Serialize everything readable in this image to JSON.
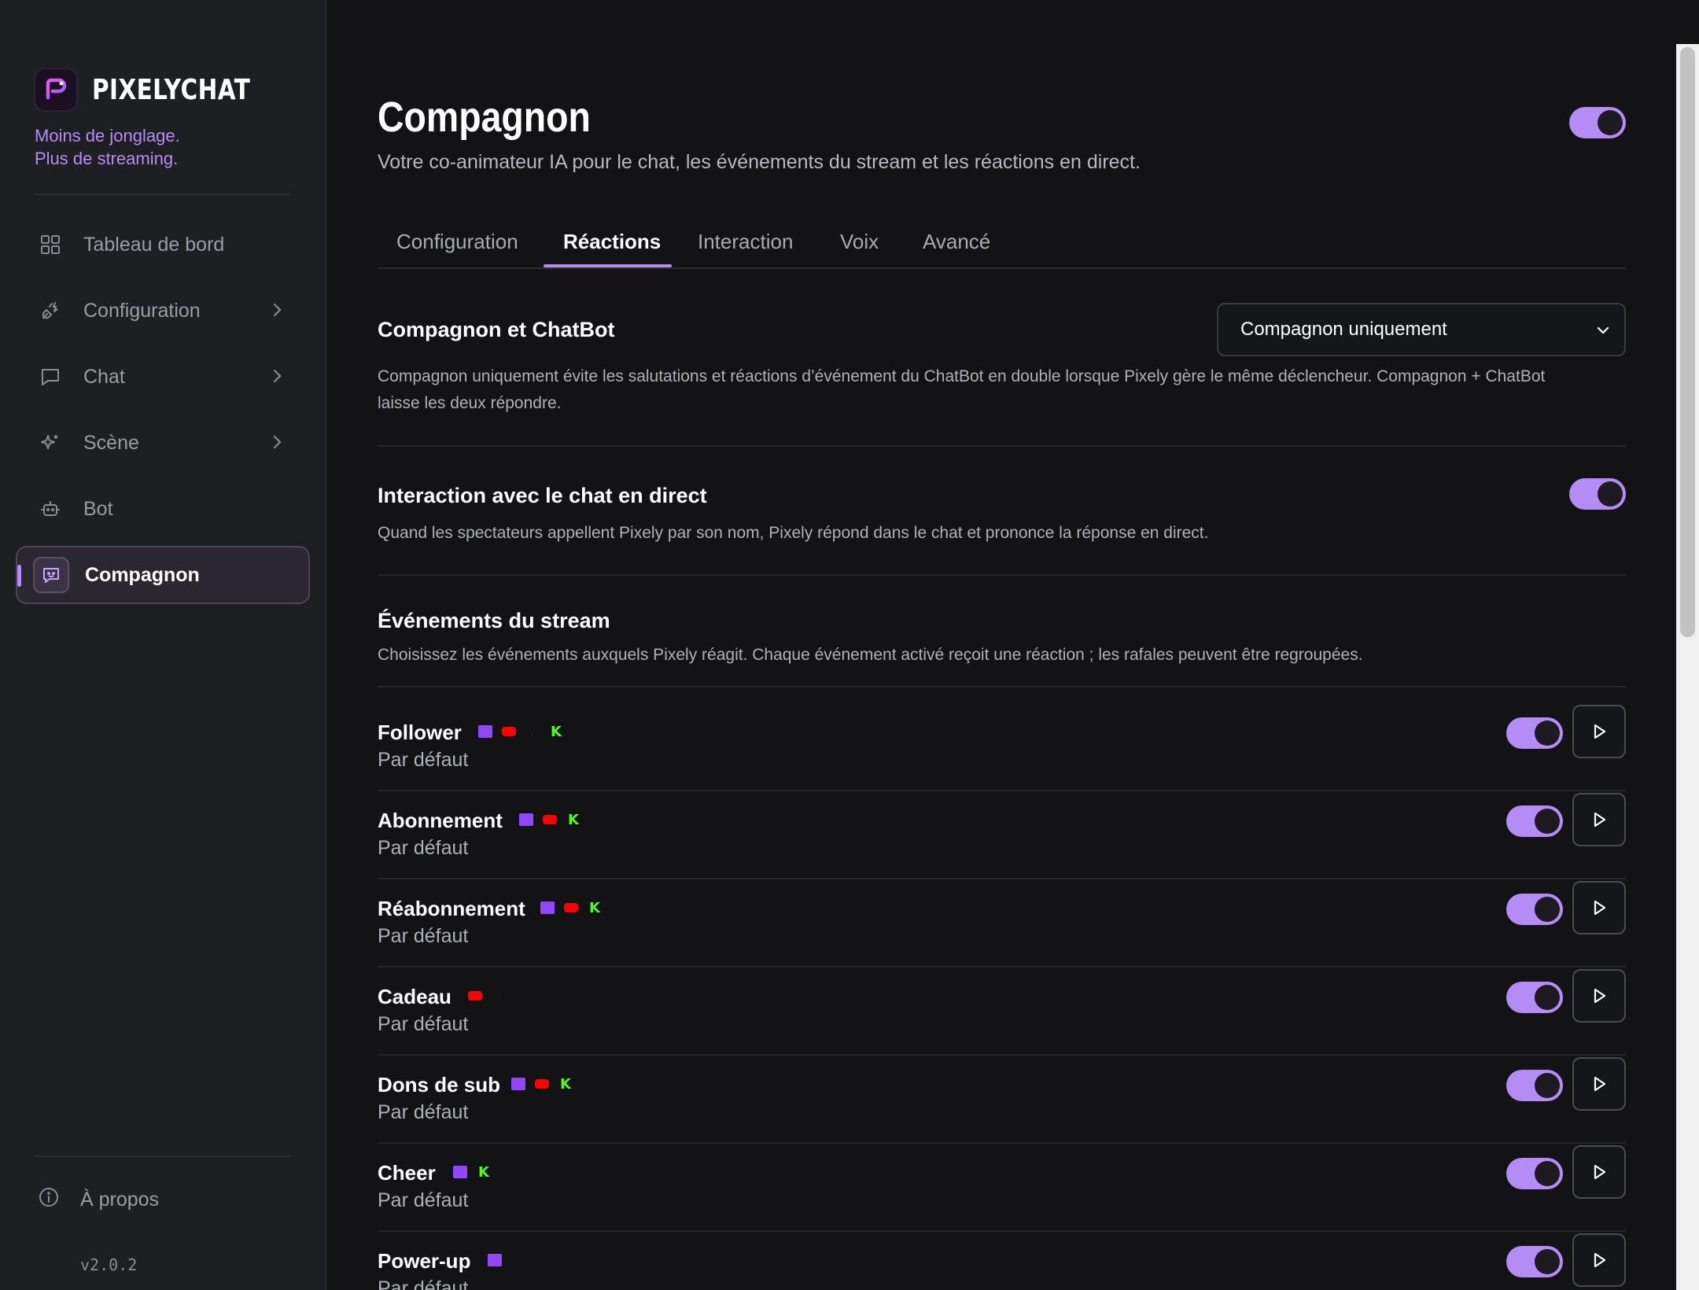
{
  "brand": {
    "name": "PIXELYCHAT",
    "tagline_line1": "Moins de jonglage.",
    "tagline_line2": "Plus de streaming."
  },
  "sidebar": {
    "items": [
      {
        "label": "Tableau de bord",
        "icon": "grid-icon"
      },
      {
        "label": "Configuration",
        "icon": "plug-icon"
      },
      {
        "label": "Chat",
        "icon": "message-icon"
      },
      {
        "label": "Scène",
        "icon": "sparkles-icon"
      },
      {
        "label": "Bot",
        "icon": "bot-icon"
      },
      {
        "label": "Compagnon",
        "icon": "companion-icon",
        "active": true
      }
    ],
    "about": "À propos",
    "version": "v2.0.2"
  },
  "header": {
    "title": "Compagnon",
    "subtitle": "Votre co-animateur IA pour le chat, les événements du stream et les réactions en direct.",
    "enabled": true
  },
  "tabs": [
    {
      "label": "Configuration"
    },
    {
      "label": "Réactions",
      "active": true
    },
    {
      "label": "Interaction"
    },
    {
      "label": "Voix"
    },
    {
      "label": "Avancé"
    }
  ],
  "companion_chatbot": {
    "title": "Compagnon et ChatBot",
    "select_value": "Compagnon uniquement",
    "desc_line1": "Compagnon uniquement évite les salutations et réactions d’événement du ChatBot en double lorsque Pixely gère le même déclencheur. Compagnon + ChatBot",
    "desc_line2": "laisse les deux répondre."
  },
  "live_chat": {
    "title": "Interaction avec le chat en direct",
    "desc": "Quand les spectateurs appellent Pixely par son nom, Pixely répond dans le chat et prononce la réponse en direct.",
    "enabled": true
  },
  "stream_events": {
    "title": "Événements du stream",
    "desc": "Choisissez les événements auxquels Pixely réagit. Chaque événement activé reçoit une réaction ; les rafales peuvent être regroupées.",
    "events": [
      {
        "name": "Follower",
        "sub": "Par défaut",
        "platforms": [
          "twitch",
          "youtube",
          "tiktok",
          "kick"
        ],
        "enabled": true
      },
      {
        "name": "Abonnement",
        "sub": "Par défaut",
        "platforms": [
          "twitch",
          "youtube",
          "kick"
        ],
        "enabled": true
      },
      {
        "name": "Réabonnement",
        "sub": "Par défaut",
        "platforms": [
          "twitch",
          "youtube",
          "kick"
        ],
        "enabled": true
      },
      {
        "name": "Cadeau",
        "sub": "Par défaut",
        "platforms": [
          "youtube",
          "tiktok"
        ],
        "enabled": true
      },
      {
        "name": "Dons de sub",
        "sub": "Par défaut",
        "platforms": [
          "twitch",
          "youtube",
          "kick"
        ],
        "enabled": true
      },
      {
        "name": "Cheer",
        "sub": "Par défaut",
        "platforms": [
          "twitch",
          "kick"
        ],
        "enabled": true
      },
      {
        "name": "Power-up",
        "sub": "Par défaut",
        "platforms": [
          "twitch"
        ],
        "enabled": true
      }
    ]
  },
  "colors": {
    "accent": "#b58cf5",
    "background": "#131316",
    "sidebar": "#1e1f23"
  }
}
